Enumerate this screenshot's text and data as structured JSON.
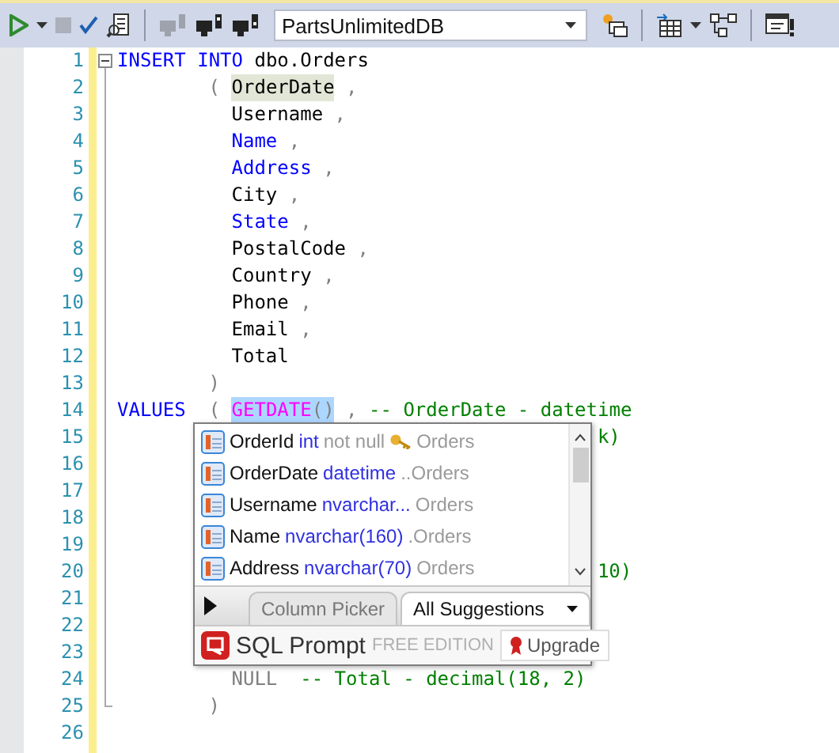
{
  "toolbar": {
    "database": "PartsUnlimitedDB"
  },
  "editor": {
    "lines": [
      {
        "number": "1",
        "tokens": [
          {
            "kind": "keyword",
            "text": "INSERT"
          },
          {
            "kind": "keyword",
            "text": " INTO"
          },
          {
            "kind": "plain",
            "text": " dbo.Orders"
          }
        ]
      },
      {
        "number": "2",
        "tokens": [
          {
            "kind": "punct",
            "text": "        ("
          },
          {
            "kind": "plain",
            "text": " OrderDate",
            "highlighted": true
          },
          {
            "kind": "punct",
            "text": " ,"
          }
        ]
      },
      {
        "number": "3",
        "tokens": [
          {
            "kind": "plain",
            "text": "          Username"
          },
          {
            "kind": "punct",
            "text": " ,"
          }
        ]
      },
      {
        "number": "4",
        "tokens": [
          {
            "kind": "keyword",
            "text": "          Name"
          },
          {
            "kind": "punct",
            "text": " ,"
          }
        ]
      },
      {
        "number": "5",
        "tokens": [
          {
            "kind": "keyword",
            "text": "          Address"
          },
          {
            "kind": "punct",
            "text": " ,"
          }
        ]
      },
      {
        "number": "6",
        "tokens": [
          {
            "kind": "plain",
            "text": "          City"
          },
          {
            "kind": "punct",
            "text": " ,"
          }
        ]
      },
      {
        "number": "7",
        "tokens": [
          {
            "kind": "keyword",
            "text": "          State"
          },
          {
            "kind": "punct",
            "text": " ,"
          }
        ]
      },
      {
        "number": "8",
        "tokens": [
          {
            "kind": "plain",
            "text": "          PostalCode"
          },
          {
            "kind": "punct",
            "text": " ,"
          }
        ]
      },
      {
        "number": "9",
        "tokens": [
          {
            "kind": "plain",
            "text": "          Country"
          },
          {
            "kind": "punct",
            "text": " ,"
          }
        ]
      },
      {
        "number": "10",
        "tokens": [
          {
            "kind": "plain",
            "text": "          Phone"
          },
          {
            "kind": "punct",
            "text": " ,"
          }
        ]
      },
      {
        "number": "11",
        "tokens": [
          {
            "kind": "plain",
            "text": "          Email"
          },
          {
            "kind": "punct",
            "text": " ,"
          }
        ]
      },
      {
        "number": "12",
        "tokens": [
          {
            "kind": "plain",
            "text": "          Total"
          }
        ]
      },
      {
        "number": "13",
        "tokens": [
          {
            "kind": "punct",
            "text": "        )"
          }
        ]
      },
      {
        "number": "14",
        "tokens": [
          {
            "kind": "keyword",
            "text": "VALUES"
          },
          {
            "kind": "punct",
            "text": "  ("
          },
          {
            "kind": "function",
            "text": " GETDATE",
            "selected": true
          },
          {
            "kind": "punct",
            "text": "()",
            "selected": true
          },
          {
            "kind": "punct",
            "text": " ,"
          },
          {
            "kind": "comment",
            "text": " -- OrderDate - datetime"
          }
        ]
      },
      {
        "number": "15",
        "tokens": [
          {
            "kind": "comment",
            "text": "                                          k)"
          }
        ]
      },
      {
        "number": "16"
      },
      {
        "number": "17"
      },
      {
        "number": "18"
      },
      {
        "number": "19"
      },
      {
        "number": "20",
        "tokens": [
          {
            "kind": "comment",
            "text": "                                          10)"
          }
        ]
      },
      {
        "number": "21"
      },
      {
        "number": "22"
      },
      {
        "number": "23"
      },
      {
        "number": "24",
        "tokens": [
          {
            "kind": "null",
            "text": "          NULL"
          },
          {
            "kind": "comment",
            "text": "  -- Total - decimal(18, 2)"
          }
        ]
      },
      {
        "number": "25",
        "tokens": [
          {
            "kind": "punct",
            "text": "        )"
          }
        ]
      },
      {
        "number": "26"
      }
    ]
  },
  "suggestions": {
    "items": [
      {
        "name": "OrderId",
        "type": "int",
        "constraint": "not null",
        "key": true,
        "table": "Orders",
        "selected": false
      },
      {
        "name": "OrderDate",
        "type": "datetime",
        "key": false,
        "table": "..Orders",
        "selected": false
      },
      {
        "name": "Username",
        "type": "nvarchar...",
        "key": false,
        "table": "Orders",
        "selected": false
      },
      {
        "name": "Name",
        "type": "nvarchar(160)",
        "key": false,
        "table": ".Orders",
        "selected": false
      },
      {
        "name": "Address",
        "type": "nvarchar(70)",
        "key": false,
        "table": "Orders",
        "selected": false
      }
    ],
    "tabs": [
      {
        "label": "Column Picker",
        "selected": false
      },
      {
        "label": "All Suggestions",
        "selected": true
      }
    ],
    "brand": "SQL Prompt",
    "edition": "FREE EDITION",
    "upgrade": "Upgrade"
  }
}
